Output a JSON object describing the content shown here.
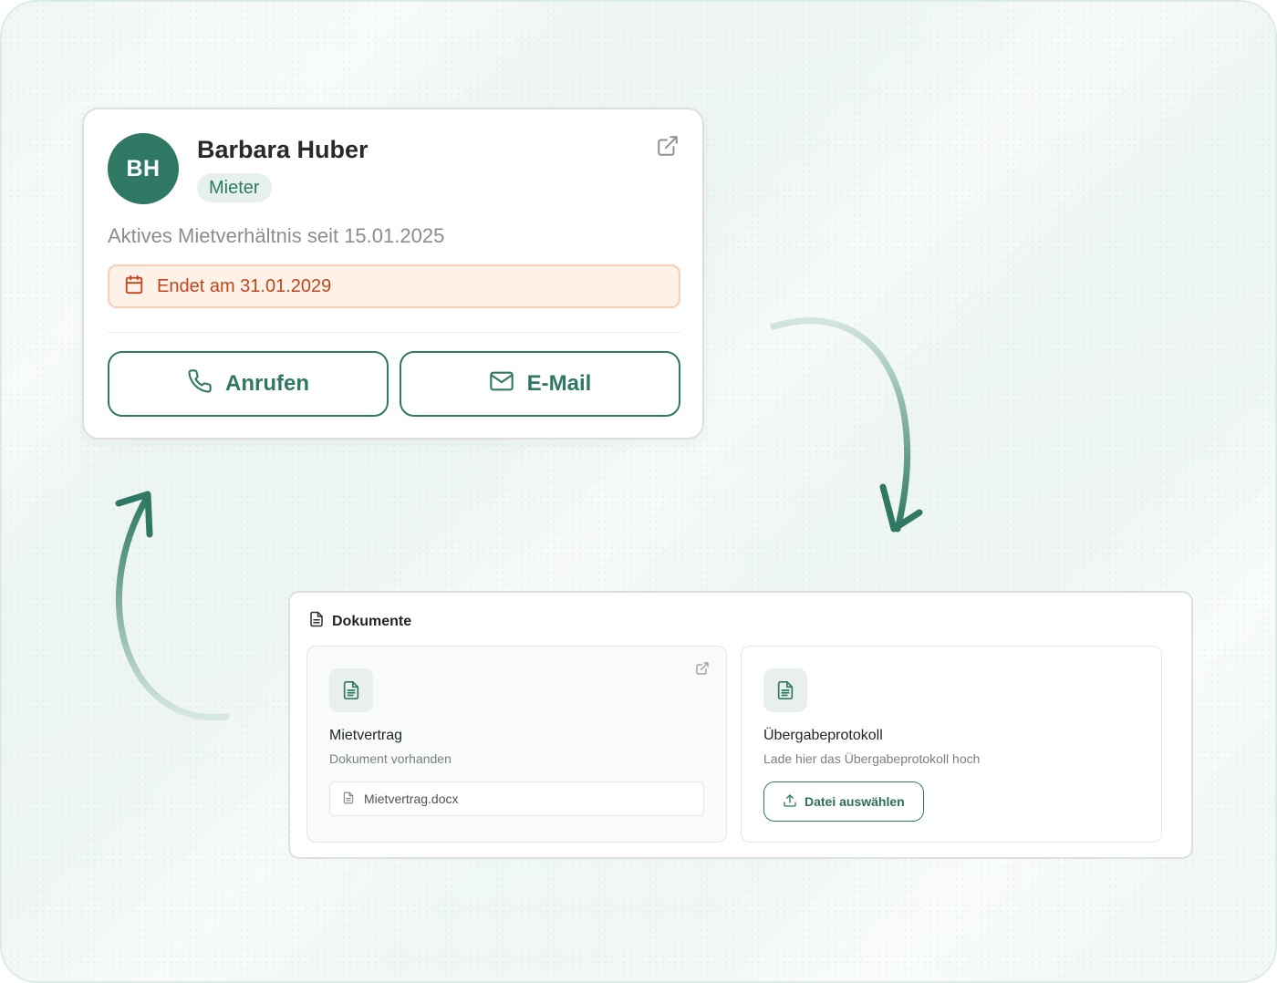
{
  "contact": {
    "initials": "BH",
    "name": "Barbara Huber",
    "role": "Mieter",
    "tenancy": "Aktives Mietverhältnis seit 15.01.2025",
    "end_notice": "Endet am 31.01.2029",
    "call_label": "Anrufen",
    "mail_label": "E-Mail"
  },
  "documents": {
    "title": "Dokumente",
    "items": [
      {
        "name": "Mietvertrag",
        "status": "Dokument vorhanden",
        "file": "Mietvertrag.docx"
      },
      {
        "name": "Übergabeprotokoll",
        "status": "Lade hier das Übergabeprotokoll hoch",
        "upload_label": "Datei auswählen"
      }
    ]
  },
  "colors": {
    "brand": "#2e7864",
    "badge_bg": "#e6f1ec",
    "warning_text": "#c2461a",
    "warning_bg": "#fef1e8",
    "warning_border": "#f6ceb6"
  },
  "icons": [
    "external-link-icon",
    "calendar-icon",
    "phone-icon",
    "mail-icon",
    "document-icon",
    "upload-icon",
    "arrow-icon"
  ]
}
